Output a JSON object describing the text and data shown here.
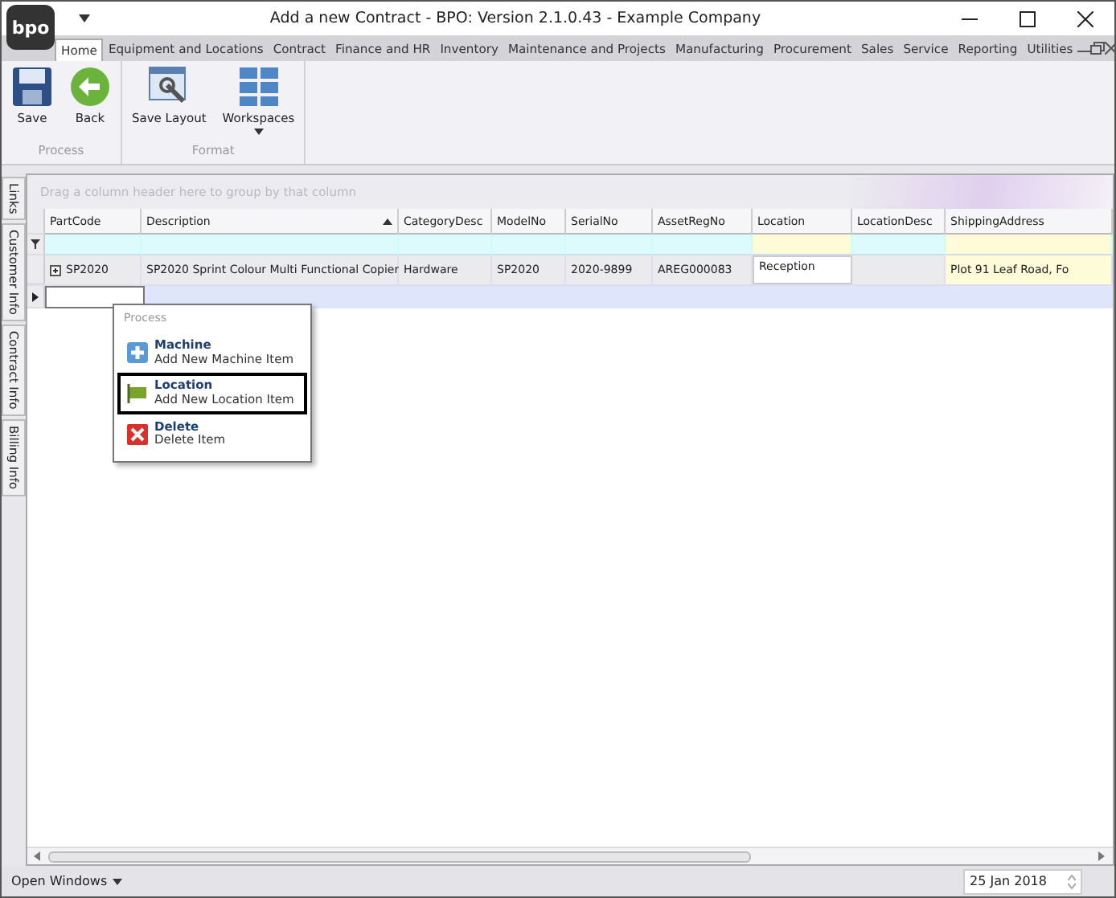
{
  "window": {
    "title": "Add a new Contract - BPO: Version 2.1.0.43 - Example Company",
    "logo": "bpo"
  },
  "ribbon_tabs": [
    {
      "label": "Home",
      "selected": true
    },
    {
      "label": "Equipment and Locations",
      "selected": false
    },
    {
      "label": "Contract",
      "selected": false
    },
    {
      "label": "Finance and HR",
      "selected": false
    },
    {
      "label": "Inventory",
      "selected": false
    },
    {
      "label": "Maintenance and Projects",
      "selected": false
    },
    {
      "label": "Manufacturing",
      "selected": false
    },
    {
      "label": "Procurement",
      "selected": false
    },
    {
      "label": "Sales",
      "selected": false
    },
    {
      "label": "Service",
      "selected": false
    },
    {
      "label": "Reporting",
      "selected": false
    },
    {
      "label": "Utilities",
      "selected": false
    }
  ],
  "ribbon_groups": [
    {
      "label": "Process",
      "buttons": [
        {
          "label": "Save",
          "kind": "save",
          "dropdown": false
        },
        {
          "label": "Back",
          "kind": "back",
          "dropdown": false
        }
      ]
    },
    {
      "label": "Format",
      "buttons": [
        {
          "label": "Save Layout",
          "kind": "layout",
          "dropdown": false
        },
        {
          "label": "Workspaces",
          "kind": "workspaces",
          "dropdown": true
        }
      ]
    }
  ],
  "side_tabs": [
    "Links",
    "Customer Info",
    "Contract Info",
    "Billing Info"
  ],
  "grid": {
    "group_panel": "Drag a column header here to group by that column",
    "columns": [
      {
        "label": "PartCode",
        "sorted": false
      },
      {
        "label": "Description",
        "sorted": true
      },
      {
        "label": "CategoryDesc",
        "sorted": false
      },
      {
        "label": "ModelNo",
        "sorted": false
      },
      {
        "label": "SerialNo",
        "sorted": false
      },
      {
        "label": "AssetRegNo",
        "sorted": false
      },
      {
        "label": "Location",
        "sorted": false
      },
      {
        "label": "LocationDesc",
        "sorted": false
      },
      {
        "label": "ShippingAddress",
        "sorted": false
      }
    ],
    "rows": [
      {
        "expandable": true,
        "cells": [
          "SP2020",
          "SP2020 Sprint Colour Multi Functional Copier",
          "Hardware",
          "SP2020",
          "2020-9899",
          "AREG000083",
          "Reception",
          "",
          "Plot 91 Leaf Road, Fo"
        ]
      }
    ]
  },
  "context_menu": {
    "header": "Process",
    "items": [
      {
        "title": "Machine",
        "subtitle": "Add New Machine Item",
        "kind": "machine",
        "selected": false
      },
      {
        "title": "Location",
        "subtitle": "Add New Location Item",
        "kind": "flag",
        "selected": true
      },
      {
        "title": "Delete",
        "subtitle": "Delete Item",
        "kind": "delete",
        "selected": false
      }
    ]
  },
  "status_bar": {
    "open_windows": "Open Windows",
    "date": "25 Jan 2018"
  }
}
